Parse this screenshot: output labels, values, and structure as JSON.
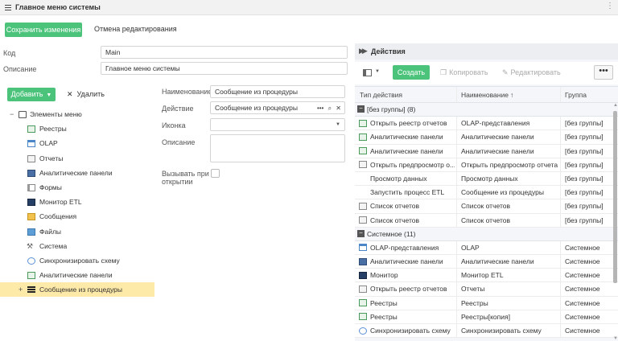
{
  "window": {
    "title": "Главное меню системы"
  },
  "toolbar": {
    "save_label": "Сохранить изменения",
    "cancel_label": "Отмена редактирования"
  },
  "form": {
    "code_label": "Код",
    "code_value": "Main",
    "description_label": "Описание",
    "description_value": "Главное меню системы"
  },
  "tree_toolbar": {
    "add_label": "Добавить",
    "delete_label": "Удалить"
  },
  "tree": {
    "root": "Элементы меню",
    "items": [
      {
        "label": "Реестры",
        "icon": "registry-icon"
      },
      {
        "label": "OLAP",
        "icon": "calendar-icon"
      },
      {
        "label": "Отчеты",
        "icon": "report-icon"
      },
      {
        "label": "Аналитические панели",
        "icon": "analytics-panel-icon"
      },
      {
        "label": "Формы",
        "icon": "form-icon"
      },
      {
        "label": "Монитор ETL",
        "icon": "monitor-icon"
      },
      {
        "label": "Сообщения",
        "icon": "message-icon"
      },
      {
        "label": "Файлы",
        "icon": "file-icon"
      },
      {
        "label": "Система",
        "icon": "tools-icon"
      },
      {
        "label": "Синхронизировать схему",
        "icon": "sync-icon"
      },
      {
        "label": "Аналитические панели",
        "icon": "analytics-doc-icon"
      },
      {
        "label": "Сообщение из процедуры",
        "icon": "list-icon",
        "selected": true
      }
    ]
  },
  "props": {
    "name_label": "Наименование",
    "name_value": "Сообщение из процедуры",
    "action_label": "Действие",
    "action_value": "Сообщение из процедуры",
    "icon_label": "Иконка",
    "icon_value": "",
    "desc_label": "Описание",
    "desc_value": "",
    "call_label_1": "Вызывать при",
    "call_label_2": "открытии",
    "call_on_open": false
  },
  "actions": {
    "panel_title": "Действия",
    "create_label": "Создать",
    "copy_label": "Копировать",
    "edit_label": "Редактировать",
    "more_label": "•••",
    "columns": [
      "Тип действия",
      "Наименование",
      "Группа"
    ],
    "sort_indicator": "↑",
    "groups": [
      {
        "label": "[без группы] (8)",
        "rows": [
          {
            "type": "Открыть реестр отчетов",
            "name": "OLAP-представления",
            "group": "[без группы]",
            "icon": "doc-icon"
          },
          {
            "type": "Аналитические панели",
            "name": "Аналитические панели",
            "group": "[без группы]",
            "icon": "doc-icon"
          },
          {
            "type": "Аналитические панели",
            "name": "Аналитические панели",
            "group": "[без группы]",
            "icon": "doc-icon"
          },
          {
            "type": "Открыть предпросмотр о...",
            "name": "Открыть предпросмотр отчета",
            "group": "[без группы]",
            "icon": "report-icon"
          },
          {
            "type": "Просмотр данных",
            "name": "Просмотр данных",
            "group": "[без группы]",
            "icon": ""
          },
          {
            "type": "Запустить процесс ETL",
            "name": "Сообщение из процедуры",
            "group": "[без группы]",
            "icon": ""
          },
          {
            "type": "Список отчетов",
            "name": "Список отчетов",
            "group": "[без группы]",
            "icon": "report-icon"
          },
          {
            "type": "Список отчетов",
            "name": "Список отчетов",
            "group": "[без группы]",
            "icon": "report-icon"
          }
        ]
      },
      {
        "label": "Системное (11)",
        "rows": [
          {
            "type": "OLAP-представления",
            "name": "OLAP",
            "group": "Системное",
            "icon": "calendar-icon"
          },
          {
            "type": "Аналитические панели",
            "name": "Аналитические панели",
            "group": "Системное",
            "icon": "user-icon"
          },
          {
            "type": "Монитор",
            "name": "Монитор ETL",
            "group": "Системное",
            "icon": "monitor-icon"
          },
          {
            "type": "Открыть реестр отчетов",
            "name": "Отчеты",
            "group": "Системное",
            "icon": "report-icon"
          },
          {
            "type": "Реестры",
            "name": "Реестры",
            "group": "Системное",
            "icon": "doc-icon"
          },
          {
            "type": "Реестры",
            "name": "Реестры[копия]",
            "group": "Системное",
            "icon": "doc-icon"
          },
          {
            "type": "Синхронизировать схему",
            "name": "Синхронизировать схему",
            "group": "Системное",
            "icon": "sync-icon"
          }
        ]
      }
    ]
  }
}
